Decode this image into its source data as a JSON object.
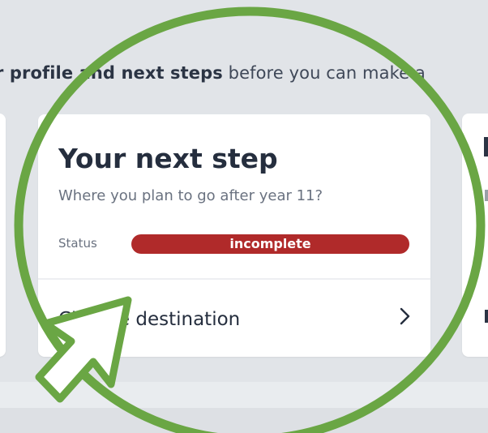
{
  "intro": {
    "prefix": "r profile",
    "and_next_steps": " and next steps",
    "rest": " before you can make a"
  },
  "card": {
    "title": "Your next step",
    "subtitle": "Where you plan to go after year 11?",
    "status_label": "Status",
    "status_value": "incomplete",
    "action_label": "Change destination",
    "chevron_icon": "chevron-right-icon"
  },
  "colors": {
    "status_incomplete": "#b02a2a",
    "highlight_circle": "#6aa644",
    "background": "#e1e4e8"
  },
  "annotations": {
    "circle_icon": "highlight-circle",
    "arrow_icon": "pointer-arrow-icon"
  }
}
